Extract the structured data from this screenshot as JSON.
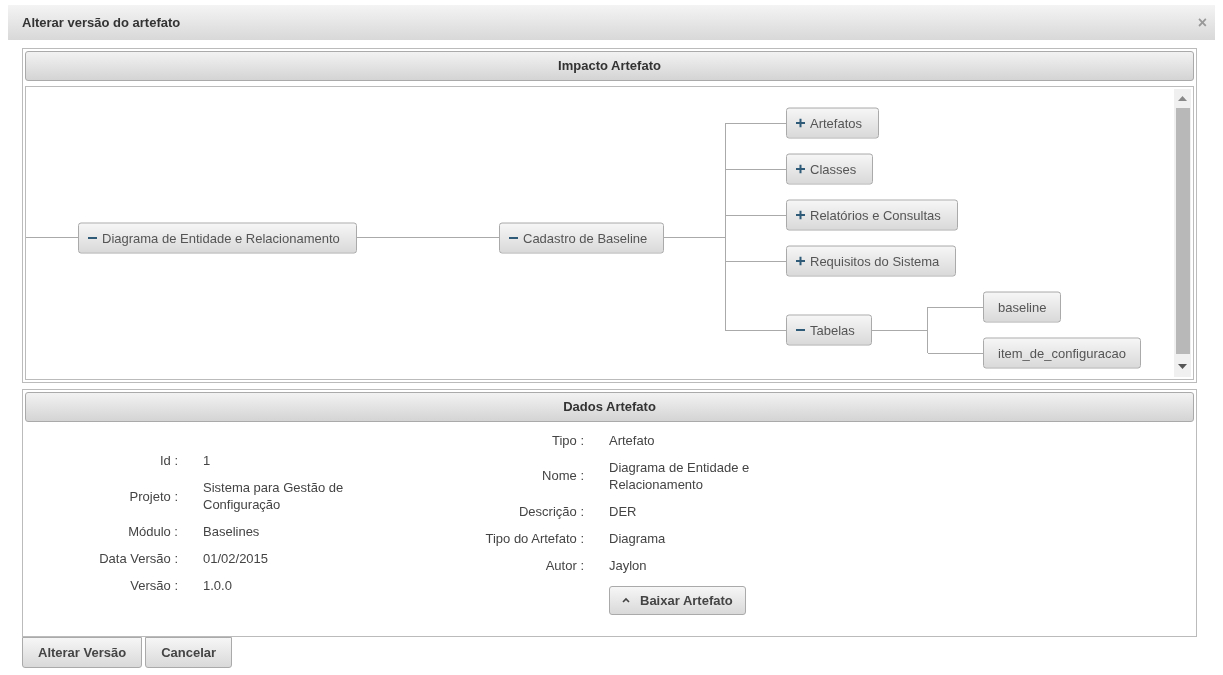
{
  "window": {
    "title": "Alterar versão do artefato",
    "close": "×"
  },
  "impact": {
    "title": "Impacto Artefato",
    "tree": [
      {
        "label": "Diagrama de Entidade e Relacionamento",
        "expanded": true,
        "children": [
          {
            "label": "Cadastro de Baseline",
            "expanded": true,
            "children": [
              {
                "label": "Artefatos",
                "expanded": false
              },
              {
                "label": "Classes",
                "expanded": false
              },
              {
                "label": "Relatórios e Consultas",
                "expanded": false
              },
              {
                "label": "Requisitos do Sistema",
                "expanded": false
              },
              {
                "label": "Tabelas",
                "expanded": true,
                "children": [
                  {
                    "label": "baseline"
                  },
                  {
                    "label": "item_de_configuracao"
                  }
                ]
              }
            ]
          }
        ]
      }
    ]
  },
  "details": {
    "title": "Dados Artefato",
    "left": [
      {
        "label": "Id :",
        "value": "1"
      },
      {
        "label": "Projeto :",
        "value": "Sistema para Gestão de Configuração"
      },
      {
        "label": "Módulo :",
        "value": "Baselines"
      },
      {
        "label": "Data Versão :",
        "value": "01/02/2015"
      },
      {
        "label": "Versão :",
        "value": "1.0.0"
      }
    ],
    "right": [
      {
        "label": "Tipo :",
        "value": "Artefato"
      },
      {
        "label": "Nome :",
        "value": "Diagrama de Entidade e Relacionamento"
      },
      {
        "label": "Descrição :",
        "value": "DER"
      },
      {
        "label": "Tipo do Artefato :",
        "value": "Diagrama"
      },
      {
        "label": "Autor :",
        "value": "Jaylon"
      }
    ],
    "download": "Baixar Artefato"
  },
  "buttons": [
    "Alterar Versão",
    "Cancelar"
  ]
}
